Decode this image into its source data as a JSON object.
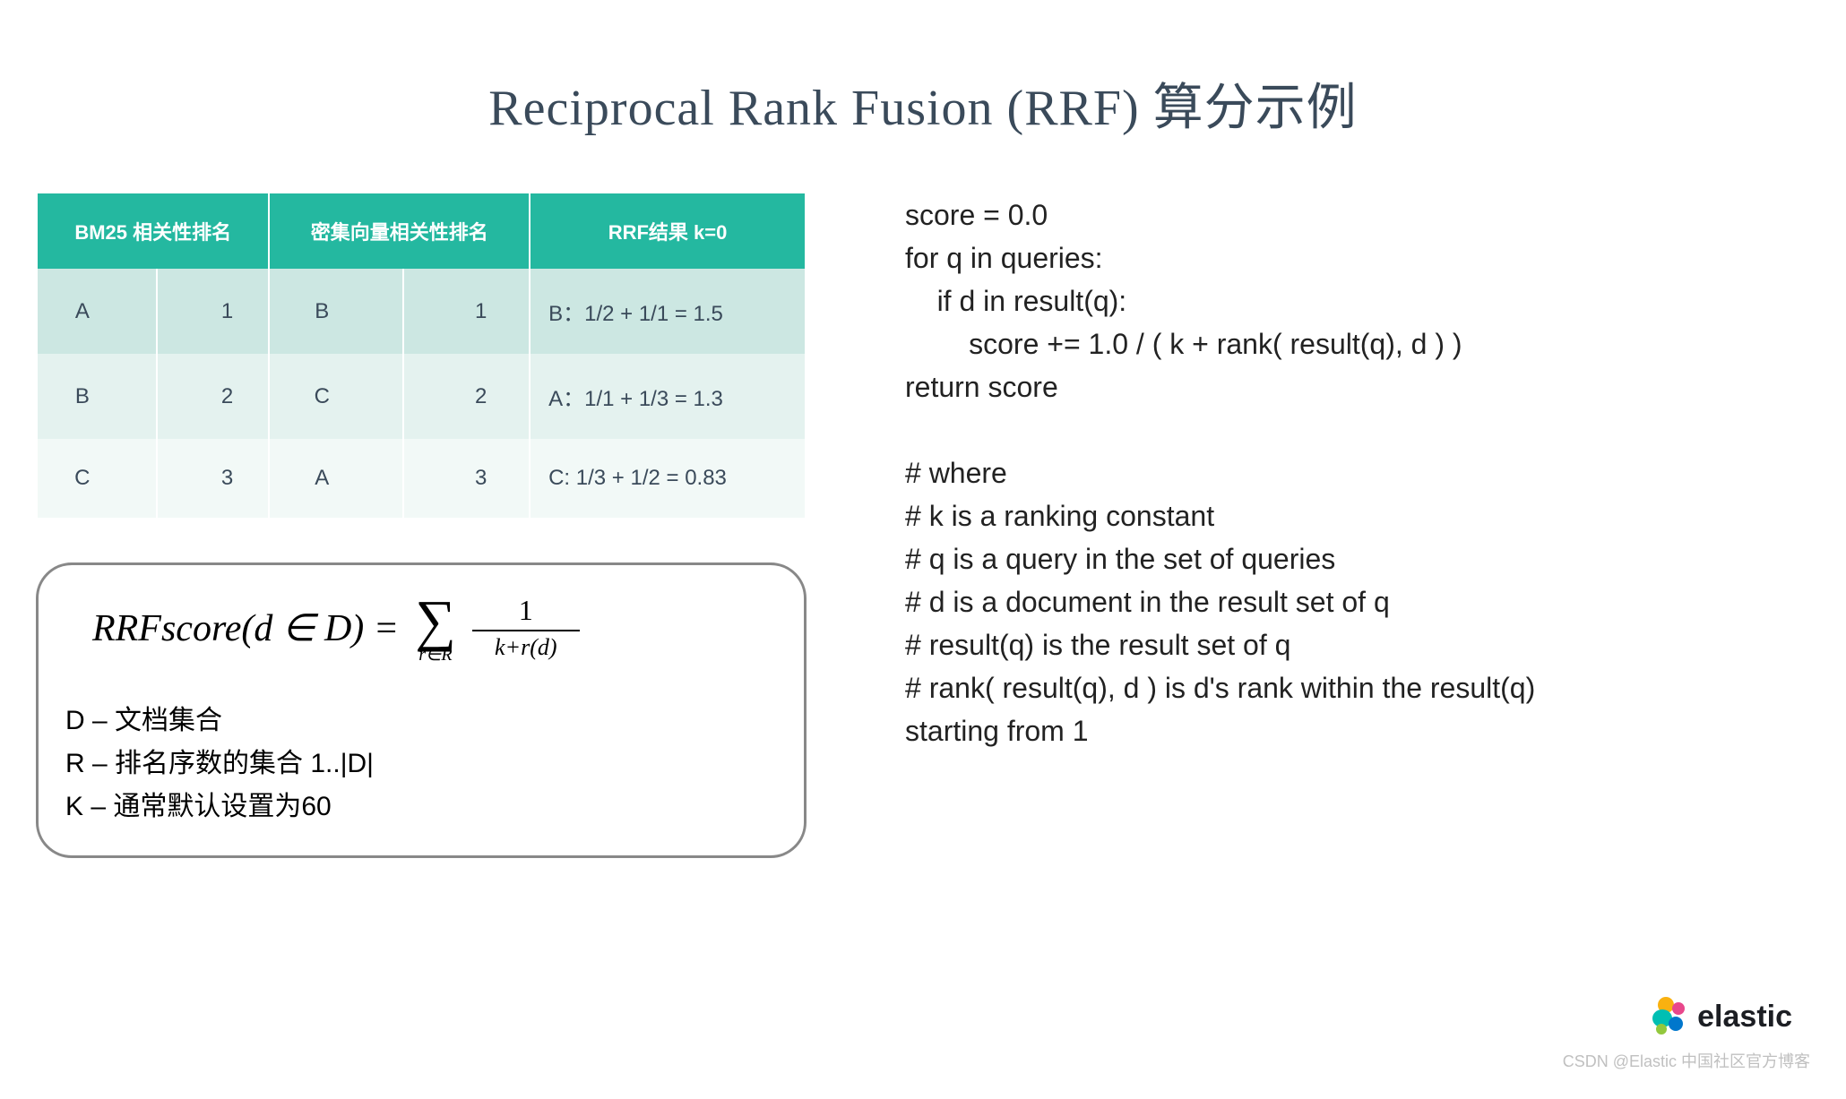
{
  "title": "Reciprocal Rank Fusion (RRF) 算分示例",
  "table": {
    "headers": [
      "BM25 相关性排名",
      "密集向量相关性排名",
      "RRF结果 k=0"
    ],
    "rows": [
      {
        "bm25_doc": "A",
        "bm25_rank": "1",
        "dense_doc": "B",
        "dense_rank": "1",
        "result": "B：1/2 + 1/1 = 1.5"
      },
      {
        "bm25_doc": "B",
        "bm25_rank": "2",
        "dense_doc": "C",
        "dense_rank": "2",
        "result": "A：1/1 + 1/3 = 1.3"
      },
      {
        "bm25_doc": "C",
        "bm25_rank": "3",
        "dense_doc": "A",
        "dense_rank": "3",
        "result": "C:   1/3 + 1/2 = 0.83"
      }
    ]
  },
  "formula": {
    "lhs": "RRFscore(d ∈ D)  =",
    "sigma_sub": "r∈R",
    "frac_num": "1",
    "frac_den": "k+r(d)",
    "legend": {
      "d": "D – 文档集合",
      "r": "R – 排名序数的集合 1..|D|",
      "k": "K – 通常默认设置为60"
    }
  },
  "code": "score = 0.0\nfor q in queries:\n    if d in result(q):\n        score += 1.0 / ( k + rank( result(q), d ) )\nreturn score\n\n# where\n# k is a ranking constant\n# q is a query in the set of queries\n# d is a document in the result set of q\n# result(q) is the result set of q\n# rank( result(q), d ) is d's rank within the result(q)\nstarting from 1",
  "brand": "elastic",
  "credit": "CSDN @Elastic 中国社区官方博客"
}
